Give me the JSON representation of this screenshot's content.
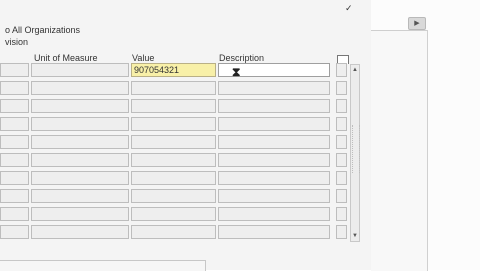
{
  "form": {
    "title": "o All Organizations",
    "subtitle": "vision",
    "checkbox_checked": true,
    "headers": {
      "unit_of_measure": "Unit of Measure",
      "value": "Value",
      "description": "Description"
    },
    "rows": [
      {
        "unit_of_measure": "",
        "value": "907054321",
        "description": ""
      },
      {
        "unit_of_measure": "",
        "value": "",
        "description": ""
      },
      {
        "unit_of_measure": "",
        "value": "",
        "description": ""
      },
      {
        "unit_of_measure": "",
        "value": "",
        "description": ""
      },
      {
        "unit_of_measure": "",
        "value": "",
        "description": ""
      },
      {
        "unit_of_measure": "",
        "value": "",
        "description": ""
      },
      {
        "unit_of_measure": "",
        "value": "",
        "description": ""
      },
      {
        "unit_of_measure": "",
        "value": "",
        "description": ""
      },
      {
        "unit_of_measure": "",
        "value": "",
        "description": ""
      },
      {
        "unit_of_measure": "",
        "value": "",
        "description": ""
      }
    ]
  },
  "icons": {
    "checkmark": "checkmark-icon",
    "scroll_up": "scroll-up-icon",
    "scroll_down": "scroll-down-icon",
    "hourglass_cursor": "hourglass-cursor-icon"
  },
  "colors": {
    "active_value_bg": "#f8f0a8",
    "field_bg": "#eeeeee",
    "panel_bg": "#f4f4f4"
  }
}
